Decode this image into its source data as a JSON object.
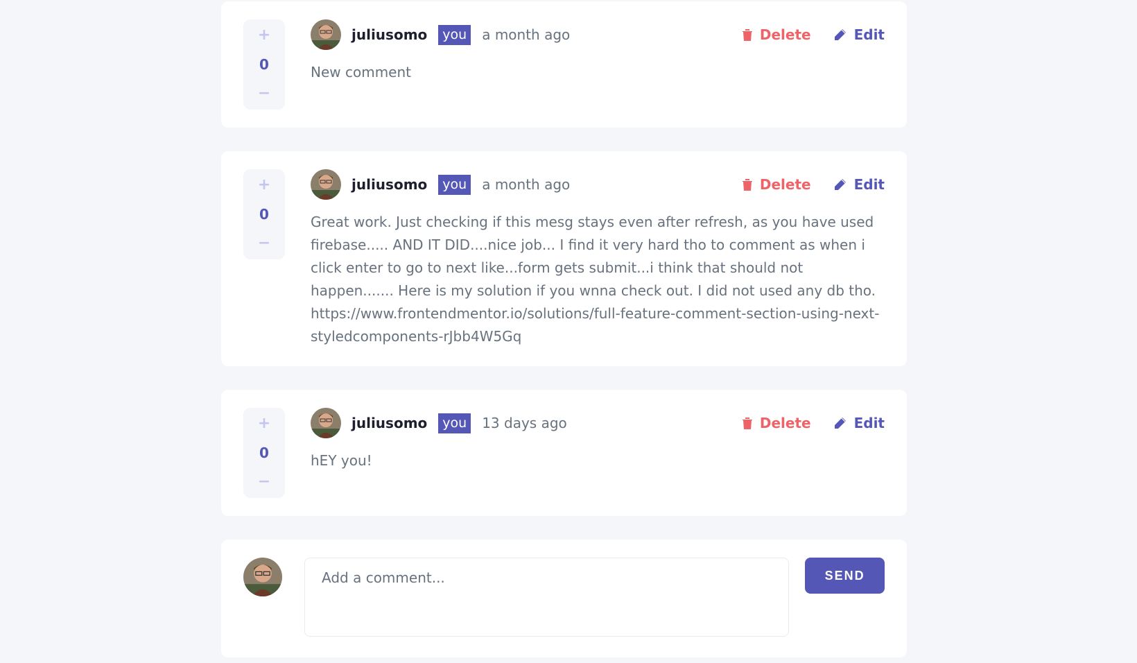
{
  "colors": {
    "accent": "#5457b6",
    "danger": "#ed6368",
    "muted": "#67727e",
    "background": "#f5f6fa"
  },
  "comments": [
    {
      "upvote_icon": "plus-icon",
      "upvote_label": "+",
      "score": "0",
      "downvote_icon": "minus-icon",
      "downvote_label": "−",
      "username": "juliusomo",
      "badge": "you",
      "timestamp": "a month ago",
      "delete_label": "Delete",
      "delete_icon": "trash-icon",
      "edit_label": "Edit",
      "edit_icon": "pencil-icon",
      "text": "New comment"
    },
    {
      "upvote_icon": "plus-icon",
      "upvote_label": "+",
      "score": "0",
      "downvote_icon": "minus-icon",
      "downvote_label": "−",
      "username": "juliusomo",
      "badge": "you",
      "timestamp": "a month ago",
      "delete_label": "Delete",
      "delete_icon": "trash-icon",
      "edit_label": "Edit",
      "edit_icon": "pencil-icon",
      "text": "Great work. Just checking if this mesg stays even after refresh, as you have used firebase..... AND IT DID....nice job... I find it very hard tho to comment as when i click enter to go to next like...form gets submit...i think that should not happen....... Here is my solution if you wnna check out. I did not used any db tho. https://www.frontendmentor.io/solutions/full-feature-comment-section-using-next-styledcomponents-rJbb4W5Gq"
    },
    {
      "upvote_icon": "plus-icon",
      "upvote_label": "+",
      "score": "0",
      "downvote_icon": "minus-icon",
      "downvote_label": "−",
      "username": "juliusomo",
      "badge": "you",
      "timestamp": "13 days ago",
      "delete_label": "Delete",
      "delete_icon": "trash-icon",
      "edit_label": "Edit",
      "edit_icon": "pencil-icon",
      "text": "hEY you!"
    }
  ],
  "composer": {
    "avatar_icon": "user-avatar",
    "placeholder": "Add a comment...",
    "value": "",
    "send_label": "SEND"
  }
}
